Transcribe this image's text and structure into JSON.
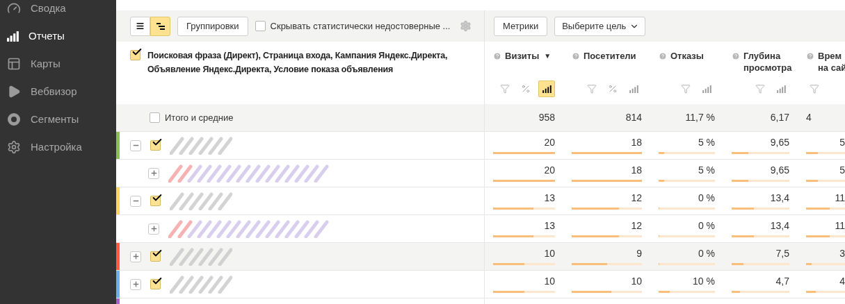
{
  "sidebar": {
    "items": [
      {
        "label": "Сводка",
        "selected": false
      },
      {
        "label": "Отчеты",
        "selected": true
      },
      {
        "label": "Карты",
        "selected": false
      },
      {
        "label": "Вебвизор",
        "selected": false
      },
      {
        "label": "Сегменты",
        "selected": false
      },
      {
        "label": "Настройка",
        "selected": false
      }
    ]
  },
  "toolbar": {
    "view_modes": [
      {
        "kind": "list",
        "selected": false
      },
      {
        "kind": "tree",
        "selected": true
      }
    ],
    "groupings_button": "Группировки",
    "hide_unreliable": {
      "label": "Скрывать статистически недостоверные ...",
      "checked": false
    },
    "metrics_button": "Метрики",
    "goal_dropdown": "Выберите цель"
  },
  "header": {
    "dimensions": {
      "label": "Поисковая фраза (Директ), Страница входа, Кампания Яндекс.Директа, Объявление Яндекс.Директа, Условие показа объявления",
      "checked": true
    },
    "columns": [
      {
        "title": [
          "Визиты"
        ],
        "sort": "▼",
        "tools": [
          {
            "kind": "filter",
            "selected": false
          },
          {
            "kind": "percent",
            "selected": false
          },
          {
            "kind": "chart",
            "selected": true
          }
        ]
      },
      {
        "title": [
          "Посетители"
        ],
        "tools": [
          {
            "kind": "filter",
            "selected": false
          },
          {
            "kind": "percent",
            "selected": false
          },
          {
            "kind": "chart",
            "selected": false
          }
        ]
      },
      {
        "title": [
          "Отказы"
        ],
        "tools": [
          {
            "kind": "filter",
            "selected": false
          },
          {
            "kind": "chart",
            "selected": false
          }
        ]
      },
      {
        "title": [
          "Глубина",
          "просмотра"
        ],
        "tools": [
          {
            "kind": "filter",
            "selected": false
          },
          {
            "kind": "chart",
            "selected": false
          }
        ]
      },
      {
        "title": [
          "Врем",
          "на сай"
        ],
        "tools": [
          {
            "kind": "filter",
            "selected": false
          }
        ]
      }
    ]
  },
  "totals": {
    "label": "Итого и средние",
    "checked": false,
    "values": [
      "958",
      "814",
      "11,7 %",
      "6,17",
      "4"
    ]
  },
  "rows": [
    {
      "color": "#8cc152",
      "expanded": true,
      "checked": true,
      "highlighted": false,
      "cells": [
        {
          "value": "20",
          "level": 1
        },
        {
          "value": "18",
          "level": 1
        },
        {
          "value": "5 %",
          "level": 0.1
        },
        {
          "value": "9,65",
          "level": 0.29
        },
        {
          "value": "5",
          "level": 0.3
        }
      ],
      "children": [
        {
          "expanded": false,
          "highlighted": false,
          "cells": [
            {
              "value": "20",
              "level": 1
            },
            {
              "value": "18",
              "level": 1
            },
            {
              "value": "5 %",
              "level": 0.1
            },
            {
              "value": "9,65",
              "level": 0.29
            },
            {
              "value": "5",
              "level": 0.3
            }
          ]
        }
      ]
    },
    {
      "color": "#ffd75e",
      "expanded": true,
      "checked": true,
      "highlighted": false,
      "cells": [
        {
          "value": "13",
          "level": 0.65
        },
        {
          "value": "12",
          "level": 0.67
        },
        {
          "value": "0 %",
          "level": 0
        },
        {
          "value": "13,4",
          "level": 0.39
        },
        {
          "value": "11",
          "level": 0.6
        }
      ],
      "children": [
        {
          "expanded": false,
          "highlighted": false,
          "cells": [
            {
              "value": "13",
              "level": 0.65
            },
            {
              "value": "12",
              "level": 0.67
            },
            {
              "value": "0 %",
              "level": 0
            },
            {
              "value": "13,4",
              "level": 0.39
            },
            {
              "value": "11",
              "level": 0.6
            }
          ]
        }
      ]
    },
    {
      "color": "#fc5c3f",
      "expanded": false,
      "checked": true,
      "highlighted": true,
      "cells": [
        {
          "value": "10",
          "level": 0.5
        },
        {
          "value": "9",
          "level": 0.5
        },
        {
          "value": "0 %",
          "level": 0
        },
        {
          "value": "7,5",
          "level": 0.21
        },
        {
          "value": "3",
          "level": 0.15
        }
      ]
    },
    {
      "color": "#6faeec",
      "expanded": false,
      "checked": true,
      "highlighted": false,
      "cells": [
        {
          "value": "10",
          "level": 0.5
        },
        {
          "value": "10",
          "level": 0.56
        },
        {
          "value": "10 %",
          "level": 0.2
        },
        {
          "value": "4,7",
          "level": 0.14
        },
        {
          "value": "4",
          "level": 0.25
        }
      ]
    },
    {
      "color": "#a45fd0"
    }
  ]
}
